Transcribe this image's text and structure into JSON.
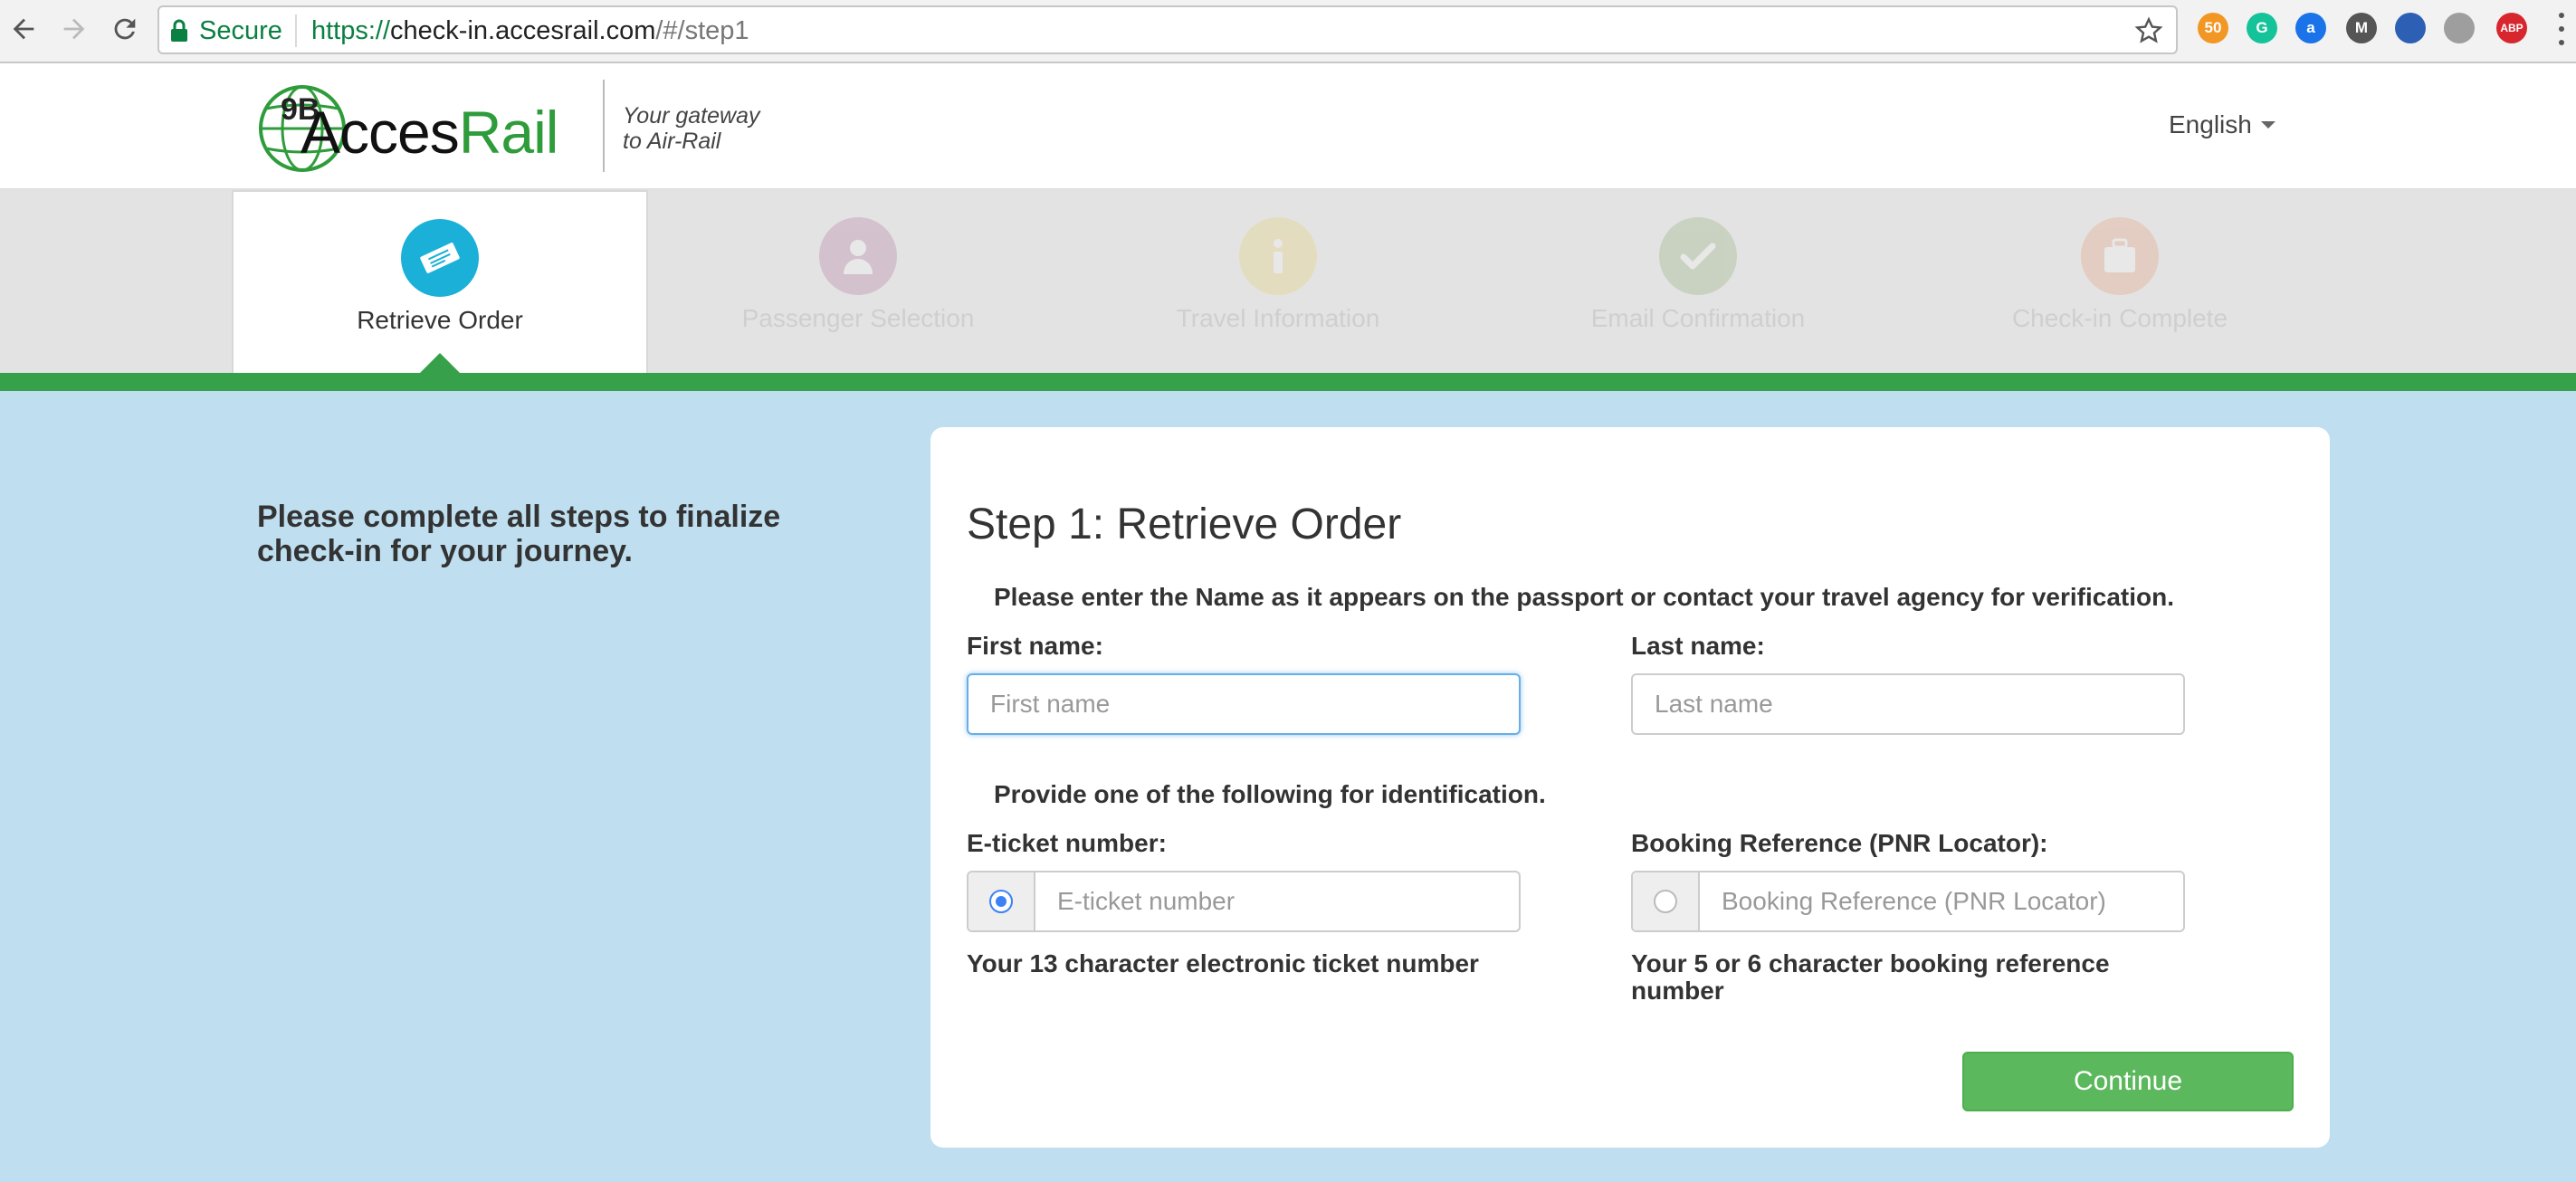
{
  "browser": {
    "secure_label": "Secure",
    "url_scheme": "https://",
    "url_host": "check-in.accesrail.com",
    "url_path": "/#/step1",
    "extensions": [
      {
        "name": "honey-extension-icon",
        "text": "50",
        "color": "#f29624"
      },
      {
        "name": "grammarly-extension-icon",
        "text": "G",
        "color": "#15c39a"
      },
      {
        "name": "amazon-assistant-extension-icon",
        "text": "a",
        "color": "#1a73e8"
      },
      {
        "name": "m-extension-icon",
        "text": "M",
        "color": "#555555"
      },
      {
        "name": "globe-extension-icon",
        "text": "",
        "color": "#2d5fb4"
      },
      {
        "name": "runner-extension-icon",
        "text": "",
        "color": "#9e9e9e"
      },
      {
        "name": "adblock-plus-extension-icon",
        "text": "ABP",
        "color": "#d8262f"
      }
    ]
  },
  "header": {
    "logo_prefix": "9B",
    "logo_acces": "Acces",
    "logo_rail": "Rail",
    "tagline_line1": "Your gateway",
    "tagline_line2": "to Air-Rail",
    "language": "English"
  },
  "steps": [
    {
      "label": "Retrieve Order",
      "icon": "ticket-icon",
      "color": "#1ab0d8",
      "active": true
    },
    {
      "label": "Passenger Selection",
      "icon": "person-icon",
      "color": "#8e2a6e",
      "active": false
    },
    {
      "label": "Travel Information",
      "icon": "info-icon",
      "color": "#e3c21a",
      "active": false
    },
    {
      "label": "Email Confirmation",
      "icon": "checkmark-icon",
      "color": "#5a8a2a",
      "active": false
    },
    {
      "label": "Check-in Complete",
      "icon": "luggage-icon",
      "color": "#e86a2a",
      "active": false
    }
  ],
  "intro_text": "Please complete all steps to finalize check-in for your journey.",
  "form": {
    "title": "Step 1: Retrieve Order",
    "name_note": "Please enter the Name as it appears on the passport or contact your travel agency for verification.",
    "first_name_label": "First name:",
    "first_name_placeholder": "First name",
    "last_name_label": "Last name:",
    "last_name_placeholder": "Last name",
    "id_note": "Provide one of the following for identification.",
    "eticket_label": "E-ticket number:",
    "eticket_placeholder": "E-ticket number",
    "eticket_help": "Your 13 character electronic ticket number",
    "pnr_label": "Booking Reference (PNR Locator):",
    "pnr_placeholder": "Booking Reference (PNR Locator)",
    "pnr_help": "Your 5 or 6 character booking reference number",
    "selected_identification": "eticket",
    "continue_label": "Continue"
  },
  "colors": {
    "accent_green": "#36a04a",
    "button_green": "#5cb85c",
    "page_background": "#bfdff0",
    "focus_blue": "#66afe9"
  }
}
